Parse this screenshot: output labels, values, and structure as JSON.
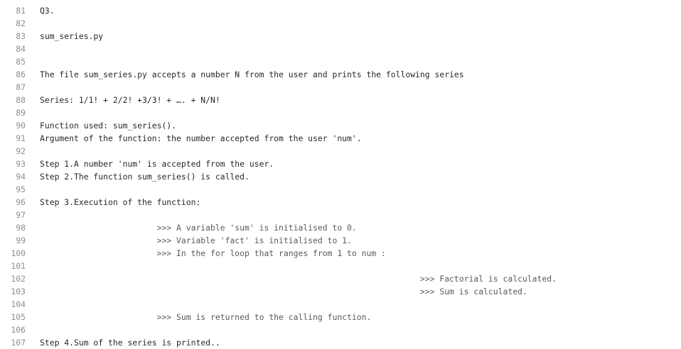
{
  "lines": [
    {
      "num": "81",
      "text": "Q3."
    },
    {
      "num": "82",
      "text": ""
    },
    {
      "num": "83",
      "text": "sum_series.py"
    },
    {
      "num": "84",
      "text": ""
    },
    {
      "num": "85",
      "text": ""
    },
    {
      "num": "86",
      "text": "The file sum_series.py accepts a number N from the user and prints the following series"
    },
    {
      "num": "87",
      "text": ""
    },
    {
      "num": "88",
      "text": "Series: 1/1! + 2/2! +3/3! + …. + N/N!"
    },
    {
      "num": "89",
      "text": ""
    },
    {
      "num": "90",
      "text": "Function used: sum_series()."
    },
    {
      "num": "91",
      "text": "Argument of the function: the number accepted from the user 'num'."
    },
    {
      "num": "92",
      "text": ""
    },
    {
      "num": "93",
      "text": "Step 1.A number 'num' is accepted from the user."
    },
    {
      "num": "94",
      "text": "Step 2.The function sum_series() is called."
    },
    {
      "num": "95",
      "text": ""
    },
    {
      "num": "96",
      "text": "Step 3.Execution of the function:"
    },
    {
      "num": "97",
      "text": ""
    },
    {
      "num": "98",
      "text": "                        >>> A variable 'sum' is initialised to 0."
    },
    {
      "num": "99",
      "text": "                        >>> Variable 'fact' is initialised to 1."
    },
    {
      "num": "100",
      "text": "                        >>> In the for loop that ranges from 1 to num :"
    },
    {
      "num": "101",
      "text": ""
    },
    {
      "num": "102",
      "text": "                                                                              >>> Factorial is calculated."
    },
    {
      "num": "103",
      "text": "                                                                              >>> Sum is calculated."
    },
    {
      "num": "104",
      "text": ""
    },
    {
      "num": "105",
      "text": "                        >>> Sum is returned to the calling function."
    },
    {
      "num": "106",
      "text": ""
    },
    {
      "num": "107",
      "text": "Step 4.Sum of the series is printed.."
    }
  ]
}
